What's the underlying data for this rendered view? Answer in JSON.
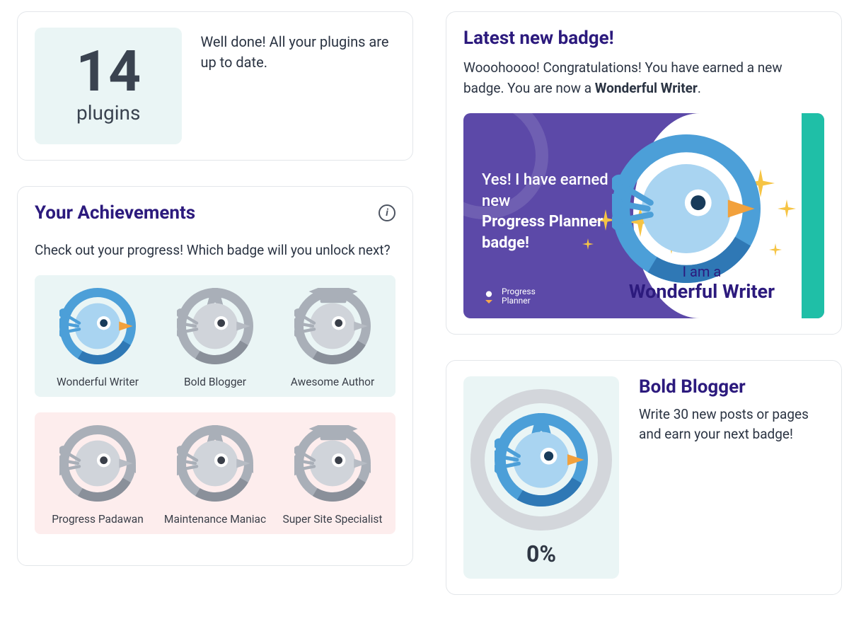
{
  "plugins": {
    "count": "14",
    "label": "plugins",
    "message": "Well done! All your plugins are up to date."
  },
  "achievements": {
    "title": "Your Achievements",
    "subtitle": "Check out your progress! Which badge will you unlock next?",
    "rows": [
      {
        "tint": "blue",
        "badges": [
          {
            "name": "Wonderful Writer",
            "state": "earned",
            "shape": "plain"
          },
          {
            "name": "Bold Blogger",
            "state": "locked",
            "shape": "star"
          },
          {
            "name": "Awesome Author",
            "state": "locked",
            "shape": "cap"
          }
        ]
      },
      {
        "tint": "pink",
        "badges": [
          {
            "name": "Progress Padawan",
            "state": "locked",
            "shape": "wings"
          },
          {
            "name": "Maintenance Maniac",
            "state": "locked",
            "shape": "star-wings"
          },
          {
            "name": "Super Site Specialist",
            "state": "locked",
            "shape": "cap-wings"
          }
        ]
      }
    ]
  },
  "latest": {
    "title": "Latest new badge!",
    "text_prefix": "Wooohoooo! Congratulations! You have earned a new badge. You are now a ",
    "text_badge": "Wonderful Writer",
    "text_suffix": ".",
    "hero_line1": "Yes! I have earned a new",
    "hero_line2": "Progress Planner badge!",
    "caption_small": "I am a",
    "caption_big": "Wonderful Writer",
    "logo_text": "Progress\nPlanner"
  },
  "next": {
    "title": "Bold Blogger",
    "desc": "Write 30 new posts or pages and earn your next badge!",
    "percent": "0%"
  }
}
